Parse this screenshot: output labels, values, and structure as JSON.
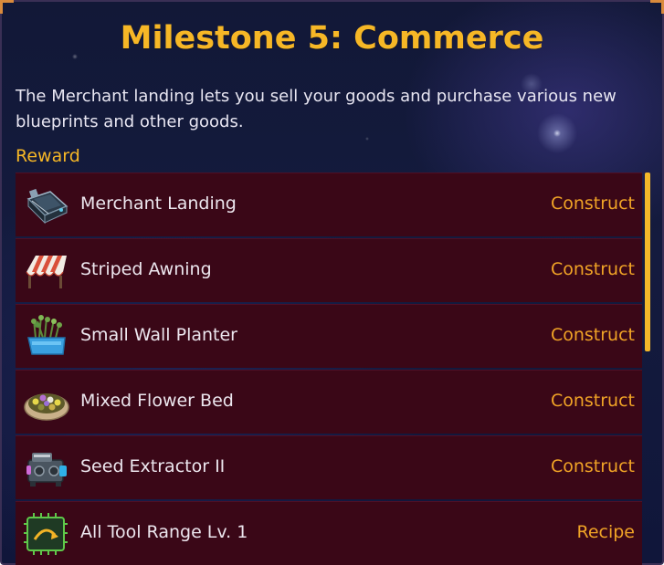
{
  "milestone": {
    "title": "Milestone 5: Commerce",
    "description": "The Merchant landing lets you sell your goods and purchase various new blueprints and other goods.",
    "reward_label": "Reward"
  },
  "rewards": [
    {
      "name": "Merchant Landing",
      "type": "Construct",
      "icon": "merchant-landing-icon"
    },
    {
      "name": "Striped Awning",
      "type": "Construct",
      "icon": "striped-awning-icon"
    },
    {
      "name": "Small Wall Planter",
      "type": "Construct",
      "icon": "wall-planter-icon"
    },
    {
      "name": "Mixed Flower Bed",
      "type": "Construct",
      "icon": "flower-bed-icon"
    },
    {
      "name": "Seed Extractor II",
      "type": "Construct",
      "icon": "seed-extractor-icon"
    },
    {
      "name": "All Tool Range Lv. 1",
      "type": "Recipe",
      "icon": "tool-range-chip-icon"
    }
  ],
  "colors": {
    "title": "#f6b726",
    "row_bg": "#3a0717",
    "type_text": "#f0a326",
    "scrollbar": "#f3b82a"
  }
}
